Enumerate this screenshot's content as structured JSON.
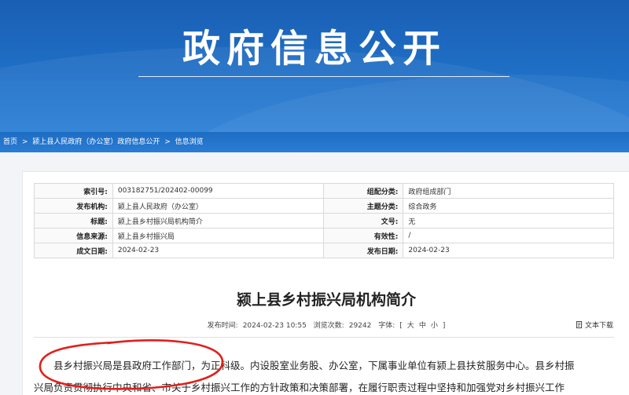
{
  "banner": {
    "title": "政府信息公开"
  },
  "breadcrumb": {
    "items": [
      "首页",
      "颍上县人民政府（办公室）政府信息公开",
      "信息浏览"
    ],
    "separator": ">"
  },
  "meta_table": {
    "rows": [
      {
        "k1": "索引号:",
        "v1": "003182751/202402-00099",
        "k2": "组配分类:",
        "v2": "政府组成部门"
      },
      {
        "k1": "发布机构:",
        "v1": "颍上县人民政府（办公室）",
        "k2": "主题分类:",
        "v2": "综合政务"
      },
      {
        "k1": "标题:",
        "v1": "颍上县乡村振兴局机构简介",
        "k2": "文号:",
        "v2": "无"
      },
      {
        "k1": "信息来源:",
        "v1": "颍上县乡村振兴局",
        "k2": "有效性:",
        "v2": "/"
      },
      {
        "k1": "成文日期:",
        "v1": "2024-02-23",
        "k2": "发布日期:",
        "v2": "2024-02-23"
      }
    ]
  },
  "article": {
    "title": "颍上县乡村振兴局机构简介",
    "publish_label": "发布时间:",
    "publish_time": "2024-02-23 10:55",
    "views_label": "浏览次数:",
    "views": "29242",
    "font_label": "字体:",
    "font_open": "[",
    "font_large": "大",
    "font_medium": "中",
    "font_small": "小",
    "font_close": "]",
    "download_label": "文本下载",
    "paragraph_1": "县乡村振兴局是县政府工作部门，为正科级。内设股室业务股、办公室，下属事业单位有颍上县扶贫服务中心。县乡村振",
    "paragraph_2": "兴局负责贯彻执行中央和省、市关于乡村振兴工作的方针政策和决策部署，在履行职责过程中坚持和加强党对乡村振兴工作"
  },
  "colors": {
    "banner_blue": "#1f6fc6",
    "annotation_red": "#e0201c"
  },
  "icons": {
    "download": "document-icon"
  }
}
